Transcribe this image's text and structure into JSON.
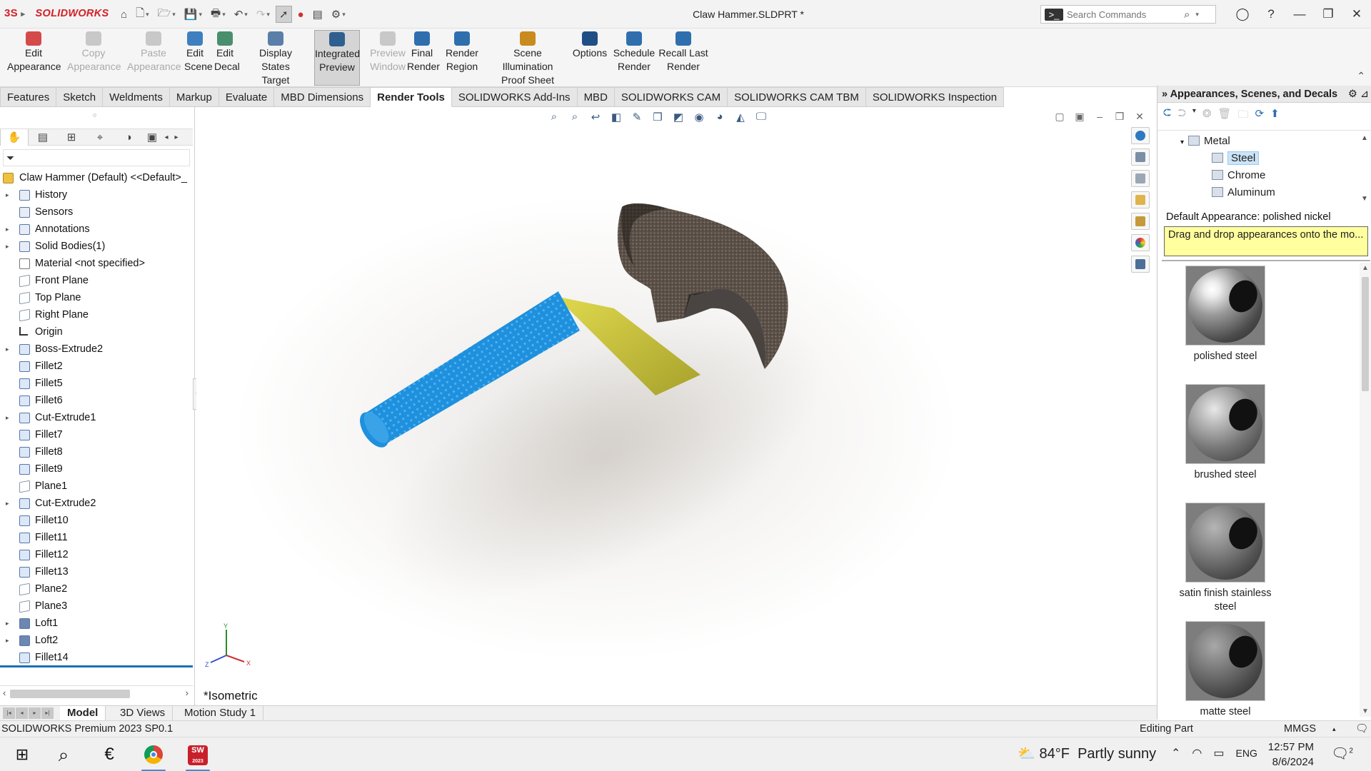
{
  "app": {
    "logo_prefix": "3S",
    "logo_name": "SOLIDWORKS",
    "doc_title": "Claw Hammer.SLDPRT *"
  },
  "search": {
    "placeholder": "Search Commands"
  },
  "window_controls": [
    "—",
    "❐",
    "✕"
  ],
  "ribbon": {
    "buttons": [
      {
        "line1": "Edit",
        "line2": "Appearance",
        "state": "enabled",
        "color": "#d44a4a"
      },
      {
        "line1": "Copy",
        "line2": "Appearance",
        "state": "disabled",
        "color": "#c8c8c8"
      },
      {
        "line1": "Paste",
        "line2": "Appearance",
        "state": "disabled",
        "color": "#c8c8c8"
      },
      {
        "line1": "Edit",
        "line2": "Scene",
        "state": "enabled",
        "color": "#3f7fbf"
      },
      {
        "line1": "Edit",
        "line2": "Decal",
        "state": "enabled",
        "color": "#4a8f6d"
      },
      {
        "line1": "Display States",
        "line2": "Target",
        "state": "enabled",
        "color": "#5a7fa8"
      },
      {
        "line1": "Integrated",
        "line2": "Preview",
        "state": "selected",
        "color": "#2e5f8f"
      },
      {
        "line1": "Preview",
        "line2": "Window",
        "state": "disabled",
        "color": "#c8c8c8"
      },
      {
        "line1": "Final",
        "line2": "Render",
        "state": "enabled",
        "color": "#2f6fae"
      },
      {
        "line1": "Render",
        "line2": "Region",
        "state": "enabled",
        "color": "#2f6fae"
      },
      {
        "line1": "Scene Illumination",
        "line2": "Proof Sheet",
        "state": "enabled",
        "color": "#c98a1e"
      },
      {
        "line1": "Options",
        "line2": "",
        "state": "enabled",
        "color": "#1f4f85"
      },
      {
        "line1": "Schedule",
        "line2": "Render",
        "state": "enabled",
        "color": "#2f6fae"
      },
      {
        "line1": "Recall Last",
        "line2": "Render",
        "state": "enabled",
        "color": "#2f6fae"
      }
    ]
  },
  "command_tabs": [
    "Features",
    "Sketch",
    "Weldments",
    "Markup",
    "Evaluate",
    "MBD Dimensions",
    "Render Tools",
    "SOLIDWORKS Add-Ins",
    "MBD",
    "SOLIDWORKS CAM",
    "SOLIDWORKS CAM TBM",
    "SOLIDWORKS Inspection"
  ],
  "active_tab": "Render Tools",
  "feature_tree": {
    "root": "Claw Hammer (Default) <<Default>_",
    "items": [
      {
        "label": "History",
        "expander": true,
        "type": "folder"
      },
      {
        "label": "Sensors",
        "expander": false,
        "type": "folder"
      },
      {
        "label": "Annotations",
        "expander": true,
        "type": "folder"
      },
      {
        "label": "Solid Bodies(1)",
        "expander": true,
        "type": "folder"
      },
      {
        "label": "Material <not specified>",
        "expander": false,
        "type": "material"
      },
      {
        "label": "Front Plane",
        "expander": false,
        "type": "plane"
      },
      {
        "label": "Top Plane",
        "expander": false,
        "type": "plane"
      },
      {
        "label": "Right Plane",
        "expander": false,
        "type": "plane"
      },
      {
        "label": "Origin",
        "expander": false,
        "type": "origin"
      },
      {
        "label": "Boss-Extrude2",
        "expander": true,
        "type": "feature"
      },
      {
        "label": "Fillet2",
        "expander": false,
        "type": "feature"
      },
      {
        "label": "Fillet5",
        "expander": false,
        "type": "feature"
      },
      {
        "label": "Fillet6",
        "expander": false,
        "type": "feature"
      },
      {
        "label": "Cut-Extrude1",
        "expander": true,
        "type": "feature"
      },
      {
        "label": "Fillet7",
        "expander": false,
        "type": "feature"
      },
      {
        "label": "Fillet8",
        "expander": false,
        "type": "feature"
      },
      {
        "label": "Fillet9",
        "expander": false,
        "type": "feature"
      },
      {
        "label": "Plane1",
        "expander": false,
        "type": "plane"
      },
      {
        "label": "Cut-Extrude2",
        "expander": true,
        "type": "feature"
      },
      {
        "label": "Fillet10",
        "expander": false,
        "type": "feature"
      },
      {
        "label": "Fillet11",
        "expander": false,
        "type": "feature"
      },
      {
        "label": "Fillet12",
        "expander": false,
        "type": "feature"
      },
      {
        "label": "Fillet13",
        "expander": false,
        "type": "feature"
      },
      {
        "label": "Plane2",
        "expander": false,
        "type": "plane"
      },
      {
        "label": "Plane3",
        "expander": false,
        "type": "plane"
      },
      {
        "label": "Loft1",
        "expander": true,
        "type": "loft"
      },
      {
        "label": "Loft2",
        "expander": true,
        "type": "loft"
      },
      {
        "label": "Fillet14",
        "expander": false,
        "type": "feature"
      }
    ]
  },
  "viewport": {
    "view_name": "*Isometric",
    "triad": {
      "x": "X",
      "y": "Y",
      "z": "Z"
    }
  },
  "right_panel": {
    "title": "Appearances, Scenes, and Decals",
    "tree": {
      "parent": "Metal",
      "children": [
        "Steel",
        "Chrome",
        "Aluminum"
      ],
      "selected": "Steel"
    },
    "default_appearance": "Default Appearance: polished nickel",
    "tooltip": "Drag and drop appearances onto the mo...",
    "swatches": [
      {
        "line1": "polished steel",
        "line2": "",
        "finish": "polished"
      },
      {
        "line1": "brushed steel",
        "line2": "",
        "finish": "brushed"
      },
      {
        "line1": "satin finish stainless",
        "line2": "steel",
        "finish": "satin"
      },
      {
        "line1": "matte steel",
        "line2": "",
        "finish": "matte"
      }
    ]
  },
  "bottom_tabs": [
    "Model",
    "3D Views",
    "Motion Study 1"
  ],
  "active_bottom_tab": "Model",
  "status": {
    "left": "SOLIDWORKS Premium 2023 SP0.1",
    "mode": "Editing Part",
    "units": "MMGS"
  },
  "taskbar": {
    "weather_temp": "84°F",
    "weather_text": "Partly sunny",
    "lang": "ENG",
    "time": "12:57 PM",
    "date": "8/6/2024",
    "notifications": "2",
    "sw_badge": "2023"
  },
  "colors": {
    "handle_grip": "#1e90dd",
    "handle_shaft": "#c8c23a",
    "head": "#5b5148",
    "accent": "#1d6fb8"
  }
}
